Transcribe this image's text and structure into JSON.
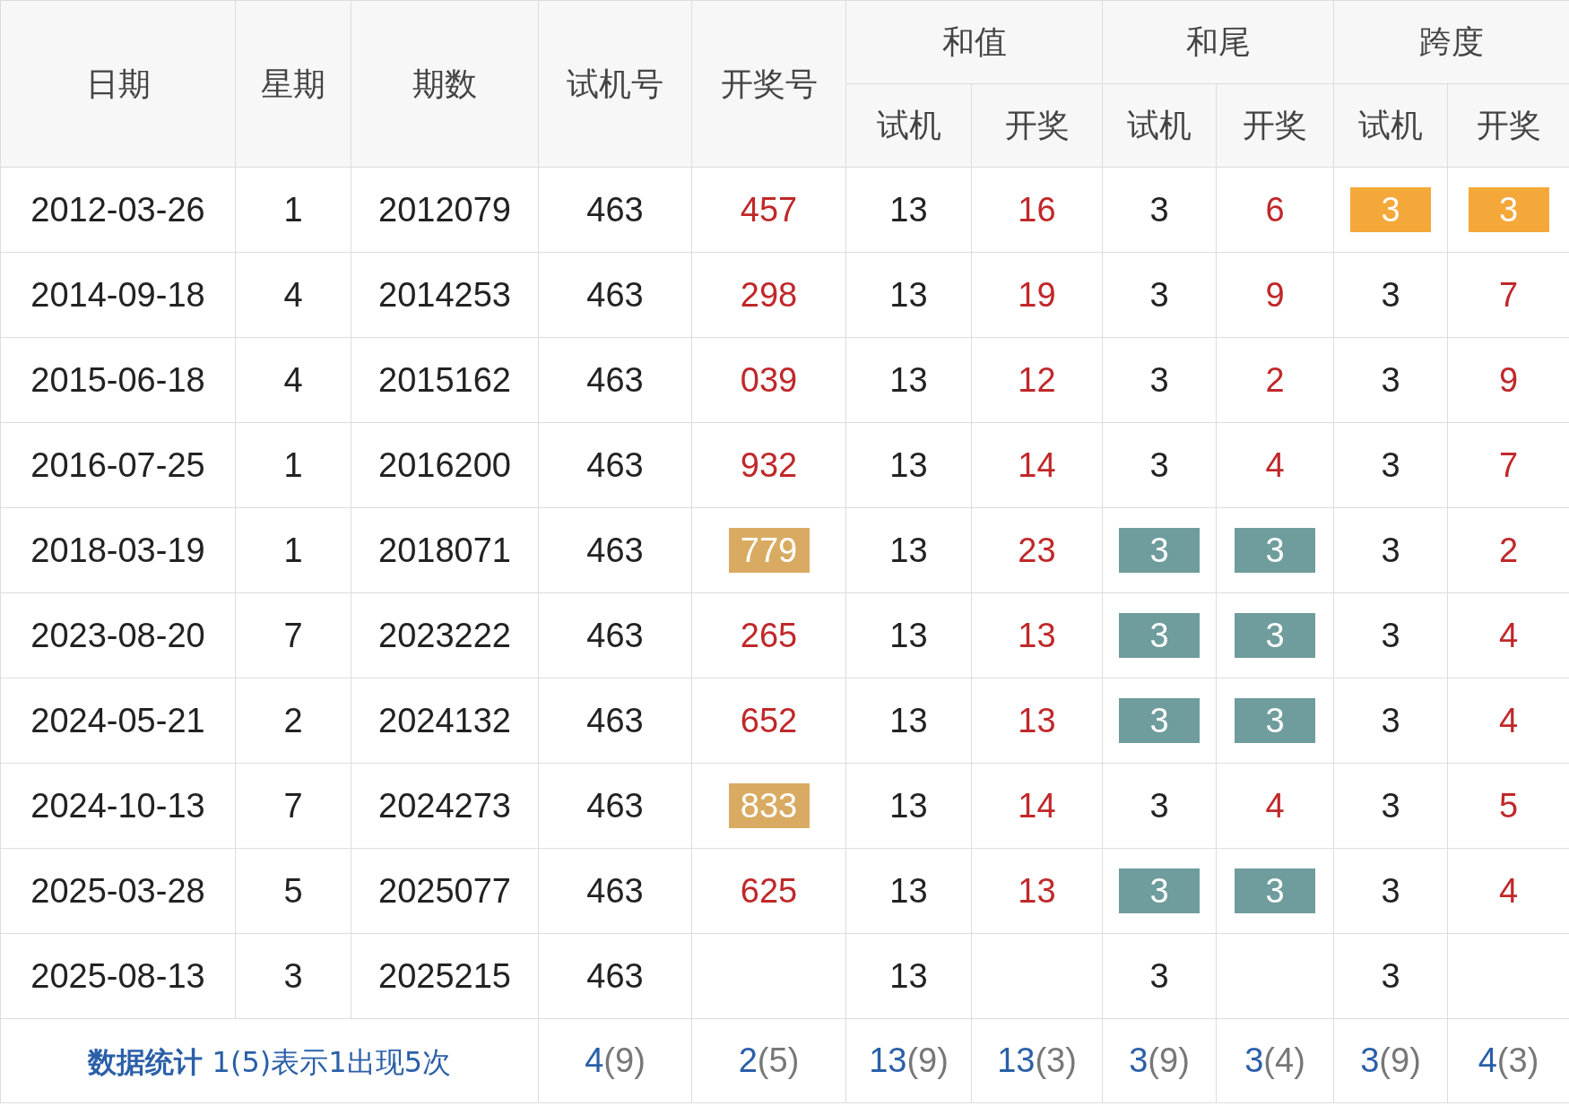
{
  "header": {
    "top": [
      {
        "label": "日期"
      },
      {
        "label": "星期"
      },
      {
        "label": "期数"
      },
      {
        "label": "试机号"
      },
      {
        "label": "开奖号"
      },
      {
        "label": "和值",
        "children": [
          {
            "label": "试机"
          },
          {
            "label": "开奖"
          }
        ]
      },
      {
        "label": "和尾",
        "children": [
          {
            "label": "试机"
          },
          {
            "label": "开奖"
          }
        ]
      },
      {
        "label": "跨度",
        "children": [
          {
            "label": "试机"
          },
          {
            "label": "开奖"
          }
        ]
      }
    ]
  },
  "columns": [
    {
      "kind": "plain"
    },
    {
      "kind": "plain"
    },
    {
      "kind": "plain"
    },
    {
      "kind": "plain"
    },
    {
      "kind": "draw"
    },
    {
      "kind": "plain"
    },
    {
      "kind": "draw"
    },
    {
      "kind": "plain"
    },
    {
      "kind": "draw"
    },
    {
      "kind": "plain"
    },
    {
      "kind": "draw"
    }
  ],
  "rows": [
    [
      {
        "text": "2012-03-26"
      },
      {
        "text": "1"
      },
      {
        "text": "2012079"
      },
      {
        "text": "463"
      },
      {
        "text": "457"
      },
      {
        "text": "13"
      },
      {
        "text": "16"
      },
      {
        "text": "3"
      },
      {
        "text": "6"
      },
      {
        "text": "3",
        "color": "#f5a83a"
      },
      {
        "text": "3",
        "color": "#f5a83a"
      }
    ],
    [
      {
        "text": "2014-09-18"
      },
      {
        "text": "4"
      },
      {
        "text": "2014253"
      },
      {
        "text": "463"
      },
      {
        "text": "298"
      },
      {
        "text": "13"
      },
      {
        "text": "19"
      },
      {
        "text": "3"
      },
      {
        "text": "9"
      },
      {
        "text": "3"
      },
      {
        "text": "7"
      }
    ],
    [
      {
        "text": "2015-06-18"
      },
      {
        "text": "4"
      },
      {
        "text": "2015162"
      },
      {
        "text": "463"
      },
      {
        "text": "039"
      },
      {
        "text": "13"
      },
      {
        "text": "12"
      },
      {
        "text": "3"
      },
      {
        "text": "2"
      },
      {
        "text": "3"
      },
      {
        "text": "9"
      }
    ],
    [
      {
        "text": "2016-07-25"
      },
      {
        "text": "1"
      },
      {
        "text": "2016200"
      },
      {
        "text": "463"
      },
      {
        "text": "932"
      },
      {
        "text": "13"
      },
      {
        "text": "14"
      },
      {
        "text": "3"
      },
      {
        "text": "4"
      },
      {
        "text": "3"
      },
      {
        "text": "7"
      }
    ],
    [
      {
        "text": "2018-03-19"
      },
      {
        "text": "1"
      },
      {
        "text": "2018071"
      },
      {
        "text": "463"
      },
      {
        "text": "779",
        "color": "#d9ab62"
      },
      {
        "text": "13"
      },
      {
        "text": "23"
      },
      {
        "text": "3",
        "color": "#6f9c9c"
      },
      {
        "text": "3",
        "color": "#6f9c9c"
      },
      {
        "text": "3"
      },
      {
        "text": "2"
      }
    ],
    [
      {
        "text": "2023-08-20"
      },
      {
        "text": "7"
      },
      {
        "text": "2023222"
      },
      {
        "text": "463"
      },
      {
        "text": "265"
      },
      {
        "text": "13"
      },
      {
        "text": "13"
      },
      {
        "text": "3",
        "color": "#6f9c9c"
      },
      {
        "text": "3",
        "color": "#6f9c9c"
      },
      {
        "text": "3"
      },
      {
        "text": "4"
      }
    ],
    [
      {
        "text": "2024-05-21"
      },
      {
        "text": "2"
      },
      {
        "text": "2024132"
      },
      {
        "text": "463"
      },
      {
        "text": "652"
      },
      {
        "text": "13"
      },
      {
        "text": "13"
      },
      {
        "text": "3",
        "color": "#6f9c9c"
      },
      {
        "text": "3",
        "color": "#6f9c9c"
      },
      {
        "text": "3"
      },
      {
        "text": "4"
      }
    ],
    [
      {
        "text": "2024-10-13"
      },
      {
        "text": "7"
      },
      {
        "text": "2024273"
      },
      {
        "text": "463"
      },
      {
        "text": "833",
        "color": "#d9ab62"
      },
      {
        "text": "13"
      },
      {
        "text": "14"
      },
      {
        "text": "3"
      },
      {
        "text": "4"
      },
      {
        "text": "3"
      },
      {
        "text": "5"
      }
    ],
    [
      {
        "text": "2025-03-28"
      },
      {
        "text": "5"
      },
      {
        "text": "2025077"
      },
      {
        "text": "463"
      },
      {
        "text": "625"
      },
      {
        "text": "13"
      },
      {
        "text": "13"
      },
      {
        "text": "3",
        "color": "#6f9c9c"
      },
      {
        "text": "3",
        "color": "#6f9c9c"
      },
      {
        "text": "3"
      },
      {
        "text": "4"
      }
    ],
    [
      {
        "text": "2025-08-13"
      },
      {
        "text": "3"
      },
      {
        "text": "2025215"
      },
      {
        "text": "463"
      },
      {
        "text": ""
      },
      {
        "text": "13"
      },
      {
        "text": ""
      },
      {
        "text": "3"
      },
      {
        "text": ""
      },
      {
        "text": "3"
      },
      {
        "text": ""
      }
    ]
  ],
  "footer": {
    "label": "数据统计",
    "note": "1(5)表示1出现5次",
    "stats": [
      {
        "value": "4",
        "count": "(9)"
      },
      {
        "value": "2",
        "count": "(5)"
      },
      {
        "value": "13",
        "count": "(9)"
      },
      {
        "value": "13",
        "count": "(3)"
      },
      {
        "value": "3",
        "count": "(9)"
      },
      {
        "value": "3",
        "count": "(4)"
      },
      {
        "value": "3",
        "count": "(9)"
      },
      {
        "value": "4",
        "count": "(3)"
      }
    ]
  }
}
